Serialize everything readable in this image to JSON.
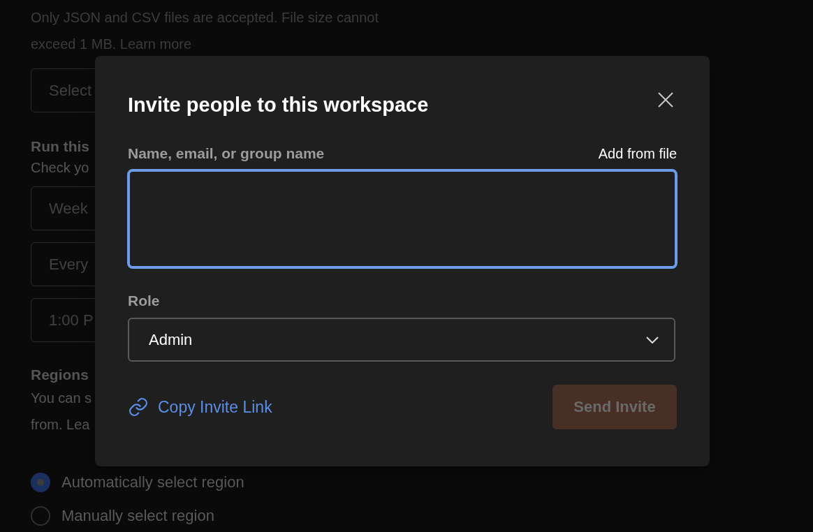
{
  "page": {
    "notice_lines": [
      "Only JSON and CSV files are accepted. File size cannot",
      "exceed 1 MB. Learn more"
    ],
    "file_select": {
      "value": "Select"
    },
    "schedule": {
      "heading": "Run this",
      "hint": "Check yo",
      "fields": [
        "Week",
        "Every",
        "1:00 P"
      ]
    },
    "regions": {
      "heading": "Regions",
      "hint_lines": [
        "You can s",
        "from. Lea"
      ],
      "options": [
        {
          "label": "Automatically select region",
          "selected": true
        },
        {
          "label": "Manually select region",
          "selected": false
        }
      ]
    }
  },
  "dialog": {
    "title": "Invite people to this workspace",
    "recipients": {
      "label": "Name, email, or group name",
      "action": "Add from file",
      "focused": true
    },
    "role": {
      "label": "Role",
      "value": "Admin"
    },
    "copy_link": "Copy Invite Link",
    "send_button": {
      "label": "Send Invite",
      "disabled": true
    }
  }
}
